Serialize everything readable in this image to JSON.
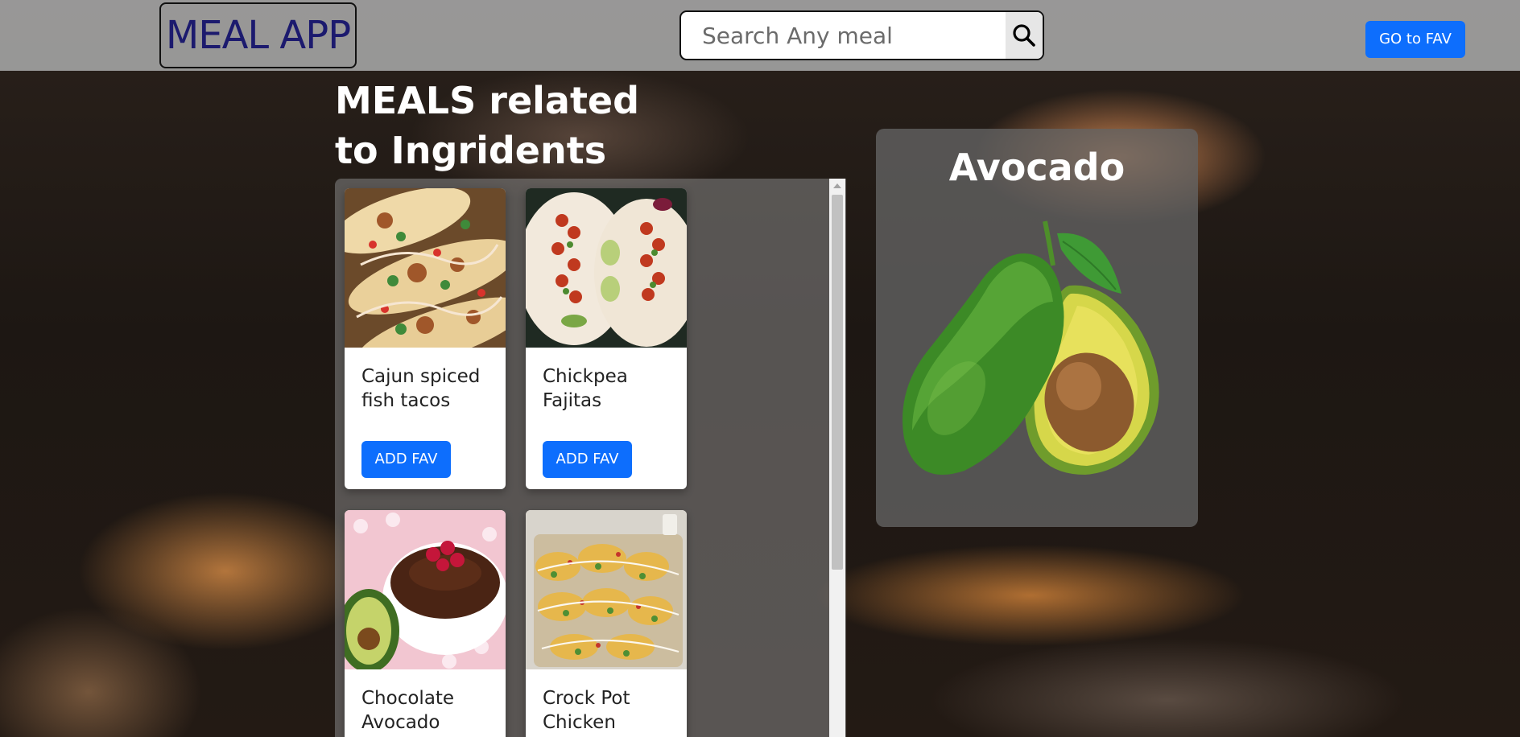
{
  "header": {
    "brand": "MEAL APP",
    "search_placeholder": "Search Any meal",
    "search_value": "",
    "go_fav_label": "GO to FAV"
  },
  "main": {
    "title": "MEALS related to Ingridents",
    "add_fav_label": "ADD FAV",
    "meals": [
      {
        "name": "Cajun spiced fish tacos",
        "image": "tacos-photo"
      },
      {
        "name": "Chickpea Fajitas",
        "image": "fajitas-photo"
      },
      {
        "name": "Chocolate Avocado",
        "image": "chocolate-avocado-photo"
      },
      {
        "name": "Crock Pot Chicken",
        "image": "crock-pot-chicken-photo"
      }
    ]
  },
  "ingredient": {
    "name": "Avocado",
    "image": "avocado-photo"
  },
  "colors": {
    "primary_button": "#0d6efd",
    "navbar": "#a0a0a0",
    "brand_text": "#1c1a6e"
  }
}
